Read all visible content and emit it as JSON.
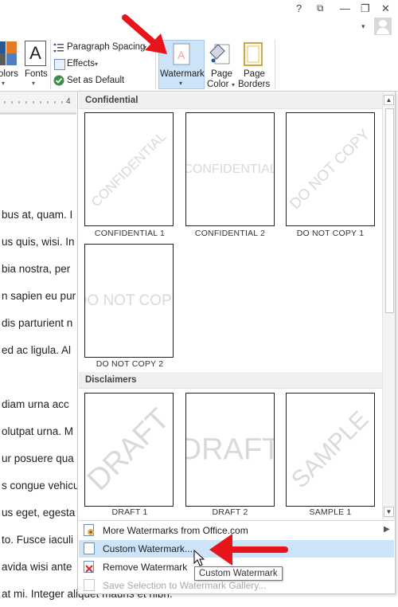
{
  "window": {
    "help": "?",
    "restore_ribbon": "⧉",
    "minimize": "—",
    "maximize": "❐",
    "close": "✕",
    "user_dropdown": "▾"
  },
  "ribbon": {
    "colors_label": "olors",
    "fonts_label": "Fonts",
    "fonts_glyph": "A",
    "paragraph_spacing": "Paragraph Spacing",
    "effects": "Effects",
    "set_as_default": "Set as Default",
    "watermark": "Watermark",
    "page_color": "Page\nColor",
    "page_color_line1": "Page",
    "page_color_line2": "Color",
    "page_borders_line1": "Page",
    "page_borders_line2": "Borders",
    "accent": "#2b579a"
  },
  "ruler": {
    "mark": "4"
  },
  "document": {
    "lines": [
      "bus at, quam. I",
      "us quis, wisi. In",
      "bia nostra, per",
      "n sapien eu pur",
      "dis parturient n",
      "ed ac ligula. Al",
      "diam urna acc",
      "olutpat urna. M",
      "ur posuere qua",
      "s congue vehicu",
      "us eget, egesta",
      "to. Fusce iaculi",
      "avida wisi ante",
      "at mi. Integer aliquet mauris et nibh."
    ]
  },
  "gallery": {
    "sections": [
      {
        "title": "Confidential"
      },
      {
        "title": "Disclaimers"
      }
    ],
    "tiles": [
      {
        "caption": "CONFIDENTIAL 1",
        "watermark": "CONFIDENTIAL"
      },
      {
        "caption": "CONFIDENTIAL 2",
        "watermark": "CONFIDENTIAL"
      },
      {
        "caption": "DO NOT COPY 1",
        "watermark": "DO NOT COPY"
      },
      {
        "caption": "DO NOT COPY 2",
        "watermark": "DO NOT COPY"
      },
      {
        "caption": "DRAFT 1",
        "watermark": "DRAFT"
      },
      {
        "caption": "DRAFT 2",
        "watermark": "DRAFT"
      },
      {
        "caption": "SAMPLE 1",
        "watermark": "SAMPLE"
      }
    ],
    "menu": [
      {
        "label": "More Watermarks from Office.com",
        "icon": "office-watermark-icon"
      },
      {
        "label": "Custom Watermark...",
        "icon": "custom-watermark-icon"
      },
      {
        "label": "Remove Watermark",
        "icon": "remove-watermark-icon"
      },
      {
        "label": "Save Selection to Watermark Gallery...",
        "icon": "save-watermark-icon"
      }
    ],
    "tooltip": "Custom Watermark"
  },
  "annotation": {
    "arrow_color": "#e8141b"
  }
}
